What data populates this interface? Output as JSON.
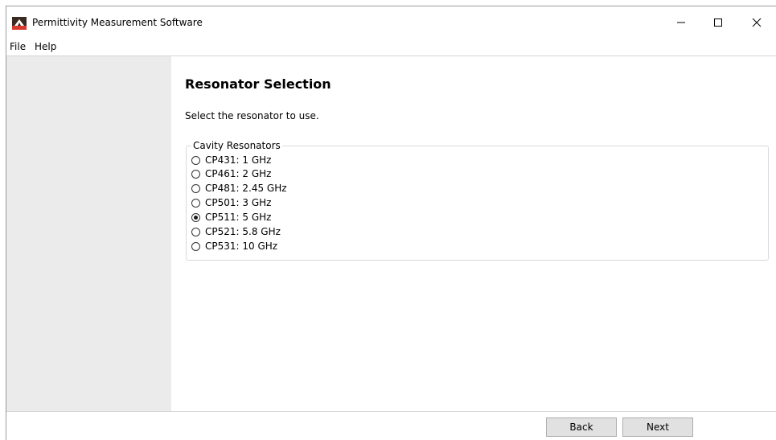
{
  "window": {
    "title": "Permittivity Measurement Software",
    "minimize_glyph": "—",
    "maximize_glyph": "☐",
    "close_glyph": "✕"
  },
  "menu": {
    "file": "File",
    "help": "Help"
  },
  "page": {
    "title": "Resonator Selection",
    "subtitle": "Select the resonator to use."
  },
  "group": {
    "legend": "Cavity Resonators",
    "options": [
      {
        "label": "CP431: 1 GHz",
        "checked": false
      },
      {
        "label": "CP461: 2 GHz",
        "checked": false
      },
      {
        "label": "CP481: 2.45 GHz",
        "checked": false
      },
      {
        "label": "CP501: 3 GHz",
        "checked": false
      },
      {
        "label": "CP511: 5 GHz",
        "checked": true
      },
      {
        "label": "CP521: 5.8 GHz",
        "checked": false
      },
      {
        "label": "CP531: 10 GHz",
        "checked": false
      }
    ]
  },
  "footer": {
    "back": "Back",
    "next": "Next"
  },
  "colors": {
    "sidebar": "#ebebeb",
    "button_face": "#e1e1e1",
    "icon_red": "#c0392b",
    "icon_dark": "#3a2a22"
  }
}
